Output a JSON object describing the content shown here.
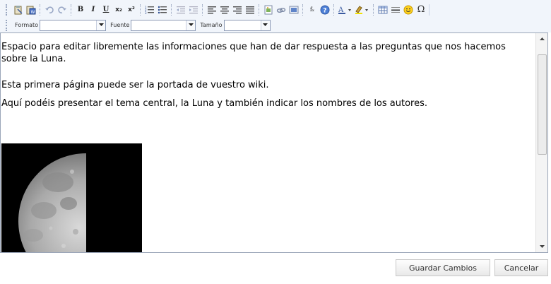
{
  "toolbar": {
    "row1_icons": [
      "paste-text-icon",
      "paste-word-icon",
      "undo-icon",
      "redo-icon",
      "bold-icon",
      "italic-icon",
      "underline-icon",
      "subscript-icon",
      "superscript-icon",
      "numbered-list-icon",
      "bulleted-list-icon",
      "outdent-icon",
      "indent-icon",
      "align-left-icon",
      "align-center-icon",
      "align-right-icon",
      "justify-icon",
      "image-icon",
      "link-icon",
      "flash-icon",
      "formula-icon",
      "help-icon",
      "text-color-icon",
      "bg-color-icon",
      "table-icon",
      "horizontal-rule-icon",
      "smiley-icon",
      "special-char-icon"
    ],
    "bold_glyph": "B",
    "italic_glyph": "I",
    "underline_glyph": "U",
    "subscript_glyph": "x₂",
    "superscript_glyph": "x²",
    "formula_glyph": "fₓ",
    "omega_glyph": "Ω",
    "format_label": "Formato",
    "font_label": "Fuente",
    "size_label": "Tamaño",
    "format_value": "",
    "font_value": "",
    "size_value": ""
  },
  "editor": {
    "paragraph1": "Espacio para editar libremente las informaciones que han de dar respuesta a las preguntas que nos hacemos sobre la Luna.",
    "paragraph2": "Esta primera página puede ser la portada de vuestro wiki.",
    "paragraph3": "Aquí podéis presentar el tema central, la Luna y también indicar los nombres de los autores."
  },
  "footer": {
    "save_label": "Guardar Cambios",
    "cancel_label": "Cancelar"
  },
  "colors": {
    "toolbar_bg": "#f1f5fb",
    "editor_border": "#9aa5b8"
  }
}
